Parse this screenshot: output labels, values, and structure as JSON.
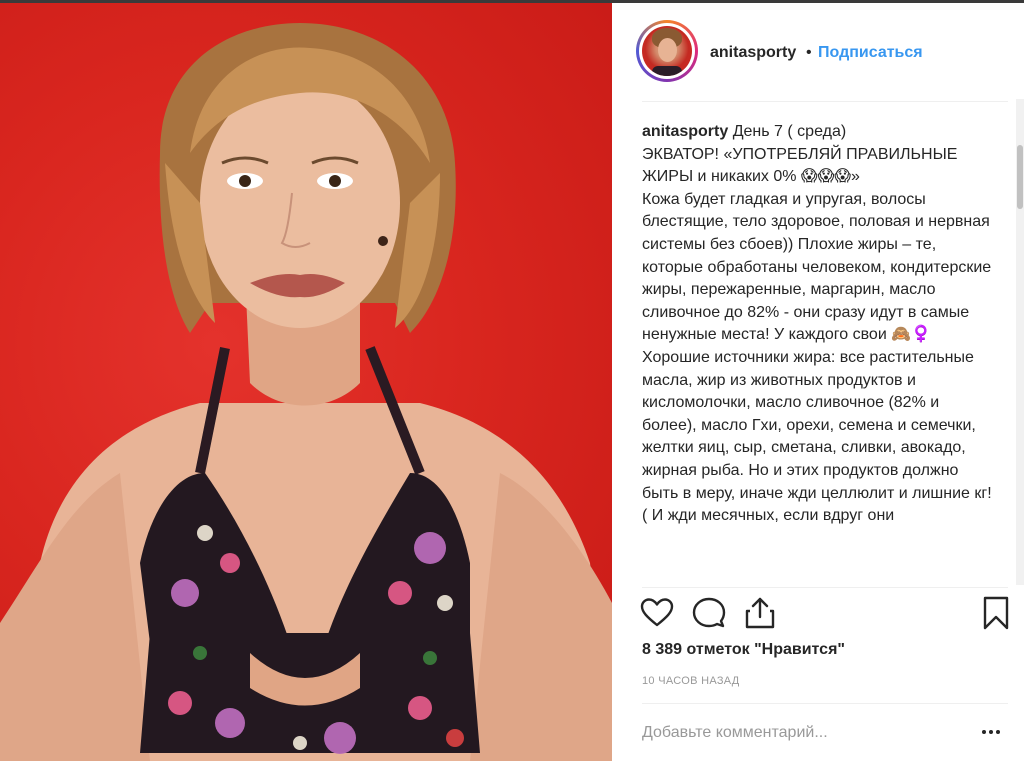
{
  "post": {
    "username": "anitasporty",
    "separator": "•",
    "follow_label": "Подписаться",
    "caption_username": "anitasporty",
    "caption_text": " День 7 ( среда)\nЭКВАТОР! «УПОТРЕБЛЯЙ ПРАВИЛЬНЫЕ ЖИРЫ и никаких 0% 😱😱😱»\nКожа будет гладкая и упругая, волосы блестящие, тело здоровое, половая и нервная системы без сбоев)) Плохие жиры – те, которые обработаны человеком, кондитерские жиры, пережаренные, маргарин, масло сливочное до 82% - они сразу идут в самые ненужные места! У каждого свои 🙈♀️\nХорошие источники жира: все растительные масла, жир из животных продуктов и кисломолочки, масло сливочное (82% и более), масло Гхи, орехи, семена и семечки, желтки яиц, сыр, сметана, сливки, авокадо, жирная рыба. Но и этих продуктов должно быть в меру, иначе жди целлюлит и лишние кг! ( И жди месячных, если вдруг они",
    "likes": "8 389 отметок \"Нравится\"",
    "time": "10 часов назад",
    "comment_placeholder": "Добавьте комментарий..."
  },
  "icons": {
    "like": "heart-icon",
    "comment": "speech-bubble-icon",
    "share": "share-upload-icon",
    "save": "bookmark-icon",
    "more": "three-dots-icon"
  },
  "colors": {
    "link": "#3897f0",
    "text": "#262626",
    "muted": "#999999",
    "photo_background": "#d9261f"
  }
}
